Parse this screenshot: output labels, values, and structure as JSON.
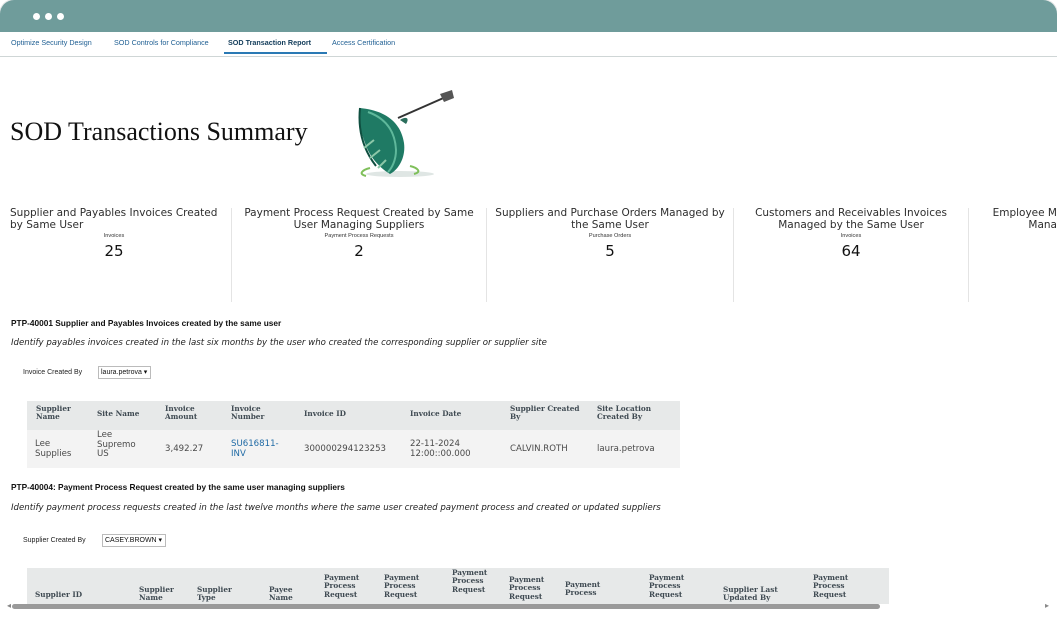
{
  "tabs": [
    {
      "label": "Optimize Security Design"
    },
    {
      "label": "SOD Controls for Compliance"
    },
    {
      "label": "SOD Transaction Report"
    },
    {
      "label": "Access Certification"
    }
  ],
  "page_title": "SOD Transactions Summary",
  "cards": [
    {
      "title": "Supplier and Payables Invoices Created by Same User",
      "subtitle": "Invoices",
      "value": "25"
    },
    {
      "title": "Payment Process Request Created by Same User Managing Suppliers",
      "subtitle": "Payment Process Requests",
      "value": "2"
    },
    {
      "title": "Suppliers and Purchase Orders Managed by the Same User",
      "subtitle": "Purchase Orders",
      "value": "5"
    },
    {
      "title": "Customers and Receivables Invoices Managed by the Same User",
      "subtitle": "Invoices",
      "value": "64"
    },
    {
      "title": "Employee M Mana",
      "subtitle": "",
      "value": ""
    }
  ],
  "section1": {
    "title": "PTP-40001 Supplier and Payables Invoices created by the same user",
    "description": "Identify payables invoices created in the last six months by the user who created the corresponding supplier or supplier site",
    "filter_label": "Invoice Created By",
    "filter_value": "laura.petrova ▾",
    "columns": [
      "Supplier Name",
      "Site Name",
      "Invoice Amount",
      "Invoice Number",
      "Invoice ID",
      "Invoice Date",
      "Supplier Created By",
      "Site Location Created By"
    ],
    "rows": [
      [
        "Lee Supplies",
        "Lee Supremo US",
        "3,492.27",
        "SU616811-INV",
        "300000294123253",
        "22-11-2024 12:00::00.000",
        "CALVIN.ROTH",
        "laura.petrova"
      ]
    ]
  },
  "section2": {
    "title": "PTP-40004: Payment Process Request created by the same user managing suppliers",
    "description": "Identify payment process requests created in the last twelve months where the same user created payment process and created or updated suppliers",
    "filter_label": "Supplier Created By",
    "filter_value": "CASEY.BROWN ▾",
    "columns": [
      "Supplier ID",
      "Supplier Name",
      "Supplier Type",
      "Payee Name",
      "Payment Process Request",
      "Payment Process Request",
      "Payment Process Request",
      "Payment Process Request",
      "Payment Process",
      "Payment Process Request",
      "Supplier Last Updated By",
      "Payment Process Request"
    ]
  },
  "colors": {
    "titlebar": "#6f9c9b",
    "link": "#1f6aa5",
    "tab_active_underline": "#2a79b4",
    "table_header": "#e7e9e9"
  }
}
